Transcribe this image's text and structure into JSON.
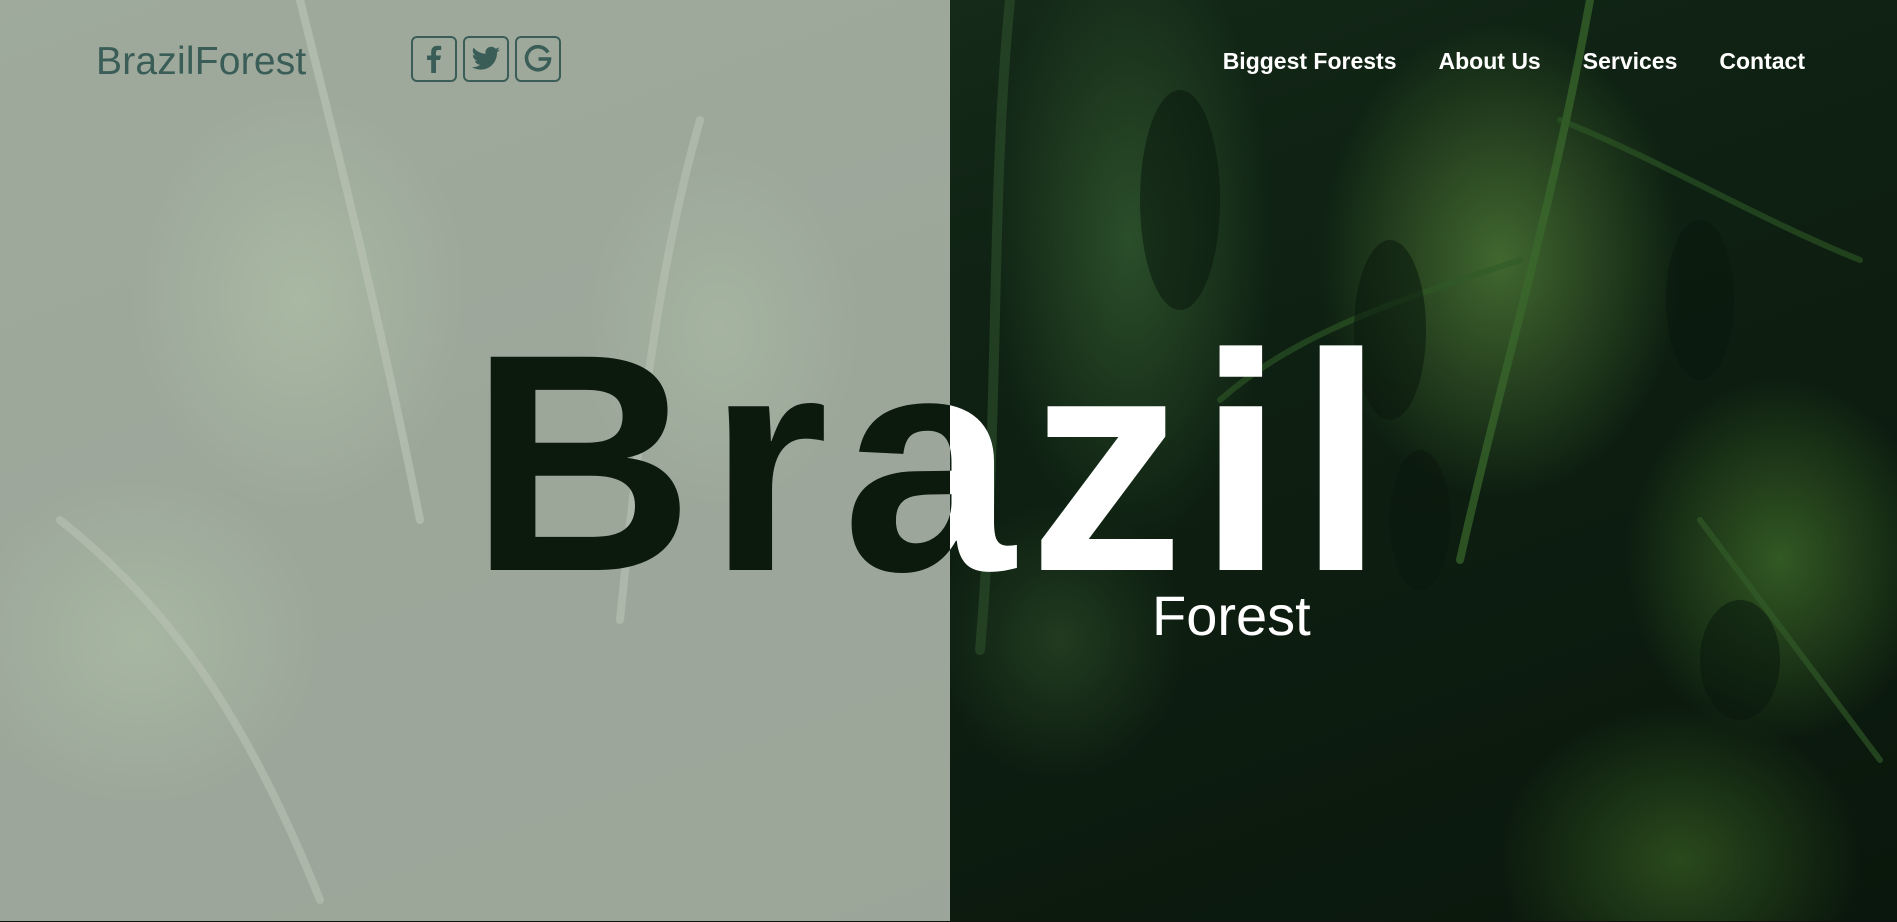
{
  "brand": {
    "name": "BrazilForest"
  },
  "social": [
    {
      "label": "f",
      "icon": "facebook-icon"
    },
    {
      "label": "t",
      "icon": "twitter-icon"
    },
    {
      "label": "G",
      "icon": "google-icon"
    }
  ],
  "nav": {
    "items": [
      {
        "label": "Biggest Forests"
      },
      {
        "label": "About Us"
      },
      {
        "label": "Services"
      },
      {
        "label": "Contact"
      }
    ]
  },
  "hero": {
    "title": "Brazil",
    "subtitle": "Forest"
  },
  "colors": {
    "brand": "#3a5e57",
    "overlay": "#bcc4b8",
    "nav_text": "#ffffff",
    "forest_dark": "#0b1a0d"
  }
}
